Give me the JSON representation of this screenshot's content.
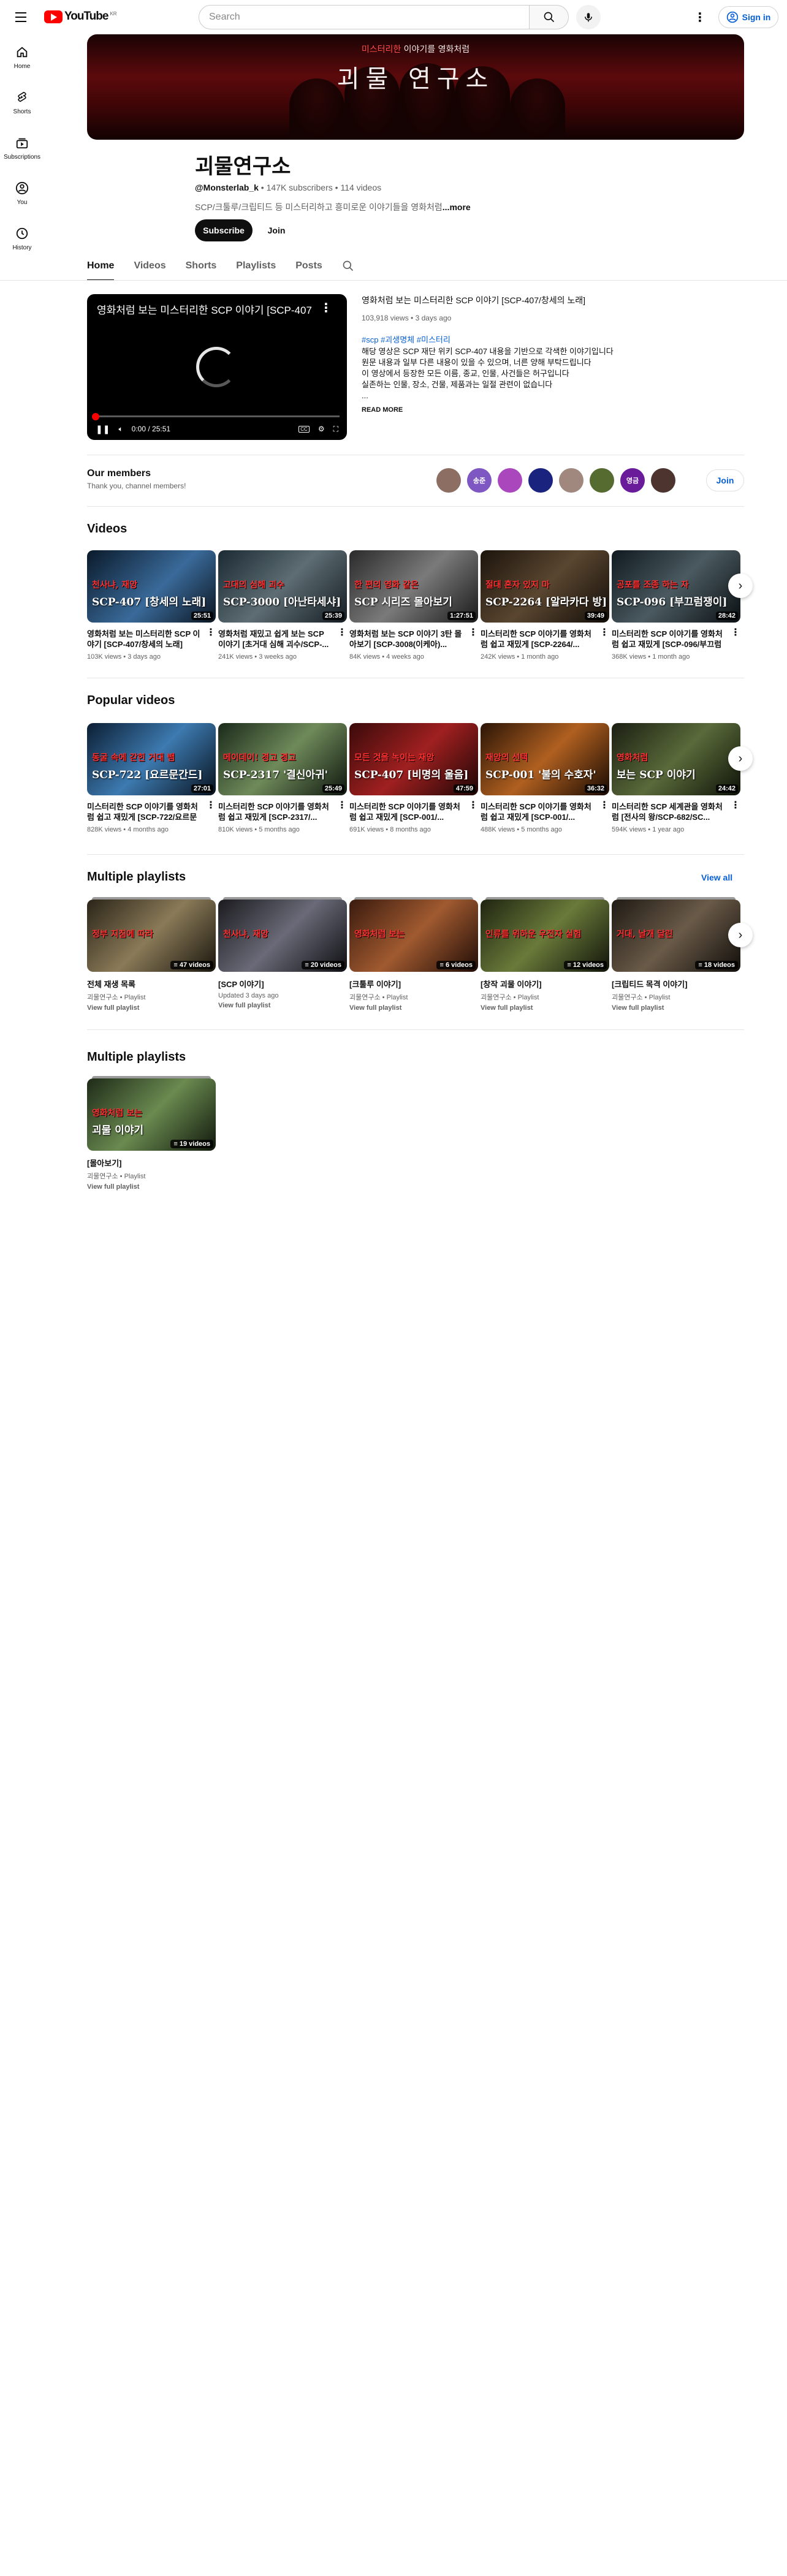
{
  "masthead": {
    "logo_text": "YouTube",
    "logo_cc": "KR",
    "search_placeholder": "Search",
    "sign_in": "Sign in"
  },
  "guide": [
    {
      "label": "Home",
      "icon": "home-icon"
    },
    {
      "label": "Shorts",
      "icon": "shorts-icon"
    },
    {
      "label": "Subscriptions",
      "icon": "subscriptions-icon"
    },
    {
      "label": "You",
      "icon": "you-icon"
    },
    {
      "label": "History",
      "icon": "history-icon"
    }
  ],
  "banner": {
    "subtitle_hl": "미스터리한",
    "subtitle_rest": " 이야기를 영화처럼",
    "title": "괴물 연구소"
  },
  "channel": {
    "name": "괴물연구소",
    "handle": "@Monsterlab_k",
    "subscribers": "147K subscribers",
    "videos": "114 videos",
    "description": "SCP/크툴루/크립티드 등 미스터리하고 흥미로운 이야기들을 영화처럼",
    "more": "...more",
    "subscribe": "Subscribe",
    "join": "Join"
  },
  "tabs": [
    "Home",
    "Videos",
    "Shorts",
    "Playlists",
    "Posts"
  ],
  "featured": {
    "player_title": "영화처럼 보는 미스터리한 SCP 이야기 [SCP-407/창세의 노래]",
    "time": "0:00 / 25:51",
    "title": "영화처럼 보는 미스터리한 SCP 이야기 [SCP-407/창세의 노래]",
    "meta": "103,918 views • 3 days ago",
    "tags": "#scp #괴생명체 #미스터리",
    "description": [
      "해당 영상은 SCP 재단 위키 SCP-407 내용을 기반으로 각색한 이야기입니다",
      "원문 내용과 일부 다른 내용이 있을 수 있으며, 너른 양해 부탁드립니다",
      "이 영상에서 등장한 모든 이름, 종교, 인물, 사건들은 허구입니다",
      "실존하는 인물, 장소, 건물, 제품과는 일절 관련이 없습니다",
      "..."
    ],
    "read_more": "READ MORE"
  },
  "members": {
    "title": "Our members",
    "subtitle": "Thank you, channel members!",
    "avatars": [
      {
        "label": "",
        "color": "#8d6e63"
      },
      {
        "label": "송준",
        "color": "#7e57c2"
      },
      {
        "label": "",
        "color": "#ab47bc"
      },
      {
        "label": "",
        "color": "#1a237e"
      },
      {
        "label": "",
        "color": "#a1887f"
      },
      {
        "label": "",
        "color": "#556b2f"
      },
      {
        "label": "영금",
        "color": "#6a1b9a"
      },
      {
        "label": "",
        "color": "#4e342e"
      }
    ],
    "join": "Join"
  },
  "videos_shelf": {
    "title": "Videos",
    "items": [
      {
        "t1": "천사냐, 재앙",
        "t2": "SCP-407 [창세의 노래]",
        "duration": "25:51",
        "title": "영화처럼 보는 미스터리한 SCP 이야기 [SCP-407/창세의 노래]",
        "meta": "103K views • 3 days ago",
        "bg": "linear-gradient(135deg,#0a1a2a,#3a6a9a 55%,#0b1520)"
      },
      {
        "t1": "고대의 심해 괴수",
        "t2": "SCP-3000 [아난타세샤]",
        "duration": "25:39",
        "title": "영화처럼 재밌고 쉽게 보는 SCP 이야기 [초거대 심해 괴수/SCP-...",
        "meta": "241K views • 3 weeks ago",
        "bg": "linear-gradient(135deg,#1b2a33,#5d6d73 50%,#141c22)"
      },
      {
        "t1": "한 편의 영화 같은",
        "t2": "SCP 시리즈 몰아보기",
        "duration": "1:27:51",
        "title": "영화처럼 보는 SCP 이야기 3탄 몰아보기 [SCP-3008(이케아)...",
        "meta": "84K views • 4 weeks ago",
        "bg": "linear-gradient(135deg,#2a2a2a,#7a7a7a 50%,#1a1a1a)"
      },
      {
        "t1": "절대 혼자 있지 마",
        "t2": "SCP-2264 [알라카다 방]",
        "duration": "39:49",
        "title": "미스터리한 SCP 이야기를 영화처럼 쉽고 재밌게 [SCP-2264/...",
        "meta": "242K views • 1 month ago",
        "bg": "linear-gradient(135deg,#1c140c,#5a4630 50%,#120d08)"
      },
      {
        "t1": "공포를 조종 하는 자",
        "t2": "SCP-096 [부끄럼쟁이]",
        "duration": "28:42",
        "title": "미스터리한 SCP 이야기를 영화처럼 쉽고 재밌게 [SCP-096/부끄럼쟁이]",
        "meta": "368K views • 1 month ago",
        "bg": "linear-gradient(135deg,#101a20,#4a5a60 50%,#0a0f12)"
      }
    ]
  },
  "popular_shelf": {
    "title": "Popular videos",
    "items": [
      {
        "t1": "동굴 속에 갇힌 거대 뱀",
        "t2": "SCP-722 [요르문간드]",
        "duration": "27:01",
        "title": "미스터리한 SCP 이야기를 영화처럼 쉽고 재밌게 [SCP-722/요르문간드]",
        "meta": "828K views • 4 months ago",
        "bg": "linear-gradient(135deg,#0c1e33,#3d7ab0 50%,#08121e)"
      },
      {
        "t1": "메이데이! 경고 경고",
        "t2": "SCP-2317 '결신아귀'",
        "duration": "25:49",
        "title": "미스터리한 SCP 이야기를 영화처럼 쉽고 재밌게 [SCP-2317/...",
        "meta": "810K views • 5 months ago",
        "bg": "linear-gradient(135deg,#1a2a1a,#6f8a5a 50%,#0e160e)"
      },
      {
        "t1": "모든 것을 녹이는 재앙",
        "t2": "SCP-407 [비명의 울음]",
        "duration": "47:59",
        "title": "미스터리한 SCP 이야기를 영화처럼 쉽고 재밌게 [SCP-001/...",
        "meta": "691K views • 8 months ago",
        "bg": "linear-gradient(135deg,#3a0a0a,#a02020 50%,#1e0505)"
      },
      {
        "t1": "재앙의 선택",
        "t2": "SCP-001 '불의 수호자'",
        "duration": "36:32",
        "title": "미스터리한 SCP 이야기를 영화처럼 쉽고 재밌게 [SCP-001/...",
        "meta": "488K views • 5 months ago",
        "bg": "linear-gradient(135deg,#2a1406,#b06020 50%,#180a02)"
      },
      {
        "t1": "영화처럼",
        "t2": "보는 SCP 이야기",
        "duration": "24:42",
        "title": "미스터리한 SCP 세계관을 영화처럼 [전사의 왕/SCP-682/SC...",
        "meta": "594K views • 1 year ago",
        "bg": "linear-gradient(135deg,#1a1e12,#5a6a3a 50%,#0e1208)"
      }
    ]
  },
  "playlists_shelf": {
    "title": "Multiple playlists",
    "view_all": "View all",
    "items": [
      {
        "t1": "정부 지침에 따라",
        "t2": "",
        "count": "47 videos",
        "title": "전체 재생 목록",
        "sub": "괴물연구소 • Playlist",
        "link": "View full playlist",
        "bg": "linear-gradient(135deg,#2a2418,#8a7a58 50%,#1a160e)"
      },
      {
        "t1": "천사냐, 재앙",
        "t2": "",
        "count": "20 videos",
        "title": "[SCP 이야기]",
        "sub": "Updated 3 days ago",
        "link": "View full playlist",
        "bg": "linear-gradient(135deg,#1a1a1e,#6a6a78 50%,#0e0e12)"
      },
      {
        "t1": "영화처럼 보는",
        "t2": "",
        "count": "6 videos",
        "title": "[크툴루 이야기]",
        "sub": "괴물연구소 • Playlist",
        "link": "View full playlist",
        "bg": "linear-gradient(135deg,#3a1a0e,#a05a30 50%,#200c06)"
      },
      {
        "t1": "인류를 위하운 우전자 실험",
        "t2": "",
        "count": "12 videos",
        "title": "[창작 괴물 이야기]",
        "sub": "괴물연구소 • Playlist",
        "link": "View full playlist",
        "bg": "linear-gradient(135deg,#1e2410,#6a7a3a 50%,#10140a)"
      },
      {
        "t1": "거대, 날개 달린",
        "t2": "",
        "count": "18 videos",
        "title": "[크립티드 목격 이야기]",
        "sub": "괴물연구소 • Playlist",
        "link": "View full playlist",
        "bg": "linear-gradient(135deg,#1e1a14,#6a5a48 50%,#100e0a)"
      }
    ]
  },
  "playlists_shelf2": {
    "title": "Multiple playlists",
    "items": [
      {
        "t1": "영화처럼 보는",
        "t2": "괴물 이야기",
        "count": "19 videos",
        "title": "[몰아보기]",
        "sub": "괴물연구소 • Playlist",
        "link": "View full playlist",
        "bg": "linear-gradient(135deg,#1e2a18,#6a8a50 50%,#10180c)"
      }
    ]
  }
}
